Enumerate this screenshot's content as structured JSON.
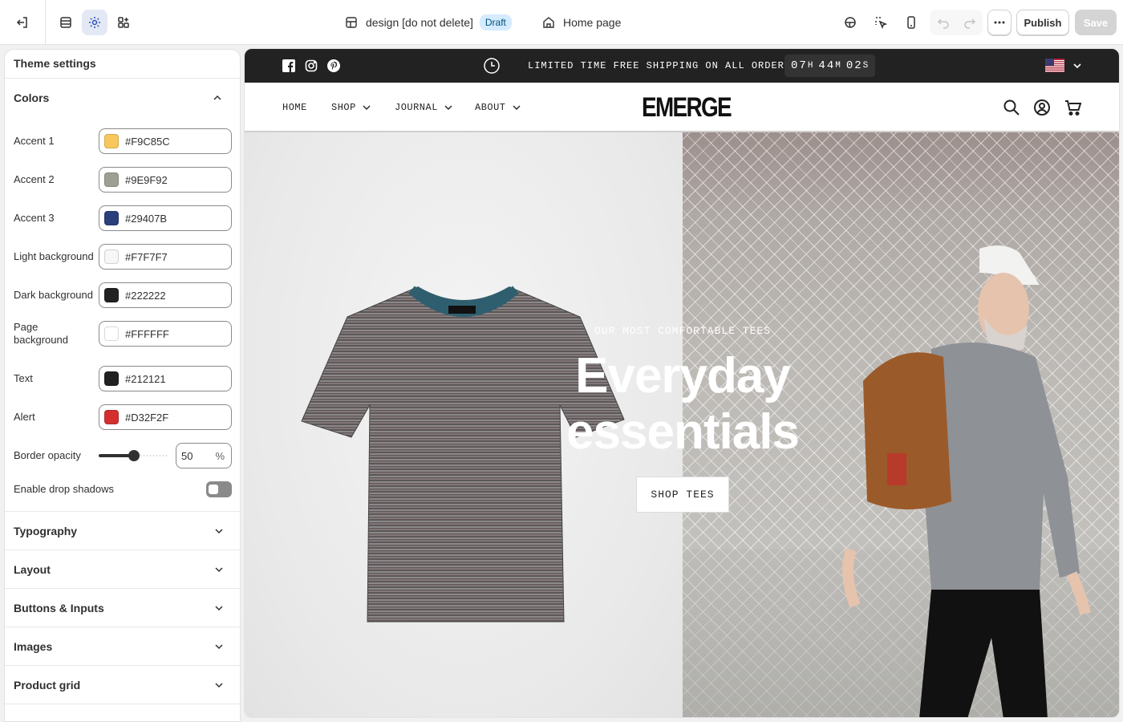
{
  "topbar": {
    "doc_name": "design [do not delete]",
    "status_badge": "Draft",
    "page_select": "Home page",
    "publish_label": "Publish",
    "save_label": "Save"
  },
  "sidebar": {
    "title": "Theme settings",
    "colors_section": "Colors",
    "colors": [
      {
        "label": "Accent 1",
        "value": "#F9C85C"
      },
      {
        "label": "Accent 2",
        "value": "#9E9F92"
      },
      {
        "label": "Accent 3",
        "value": "#29407B"
      },
      {
        "label": "Light background",
        "value": "#F7F7F7"
      },
      {
        "label": "Dark background",
        "value": "#222222"
      },
      {
        "label": "Page background",
        "value": "#FFFFFF"
      },
      {
        "label": "Text",
        "value": "#212121"
      },
      {
        "label": "Alert",
        "value": "#D32F2F"
      }
    ],
    "border_opacity": {
      "label": "Border opacity",
      "value": "50",
      "unit": "%"
    },
    "drop_shadows": {
      "label": "Enable drop shadows",
      "enabled": false
    },
    "sections": [
      "Typography",
      "Layout",
      "Buttons & Inputs",
      "Images",
      "Product grid"
    ]
  },
  "preview": {
    "announcement": "LIMITED TIME FREE SHIPPING ON ALL ORDERS",
    "countdown": {
      "hours": "07",
      "h": "H",
      "minutes": "44",
      "m": "M",
      "seconds": "02",
      "s": "S"
    },
    "nav": [
      "HOME",
      "SHOP",
      "JOURNAL",
      "ABOUT"
    ],
    "logo": "EMERGE",
    "hero": {
      "subtitle": "OUR MOST COMFORTABLE TEES",
      "title_line1": "Everyday",
      "title_line2": "essentials",
      "button": "SHOP TEES"
    }
  }
}
